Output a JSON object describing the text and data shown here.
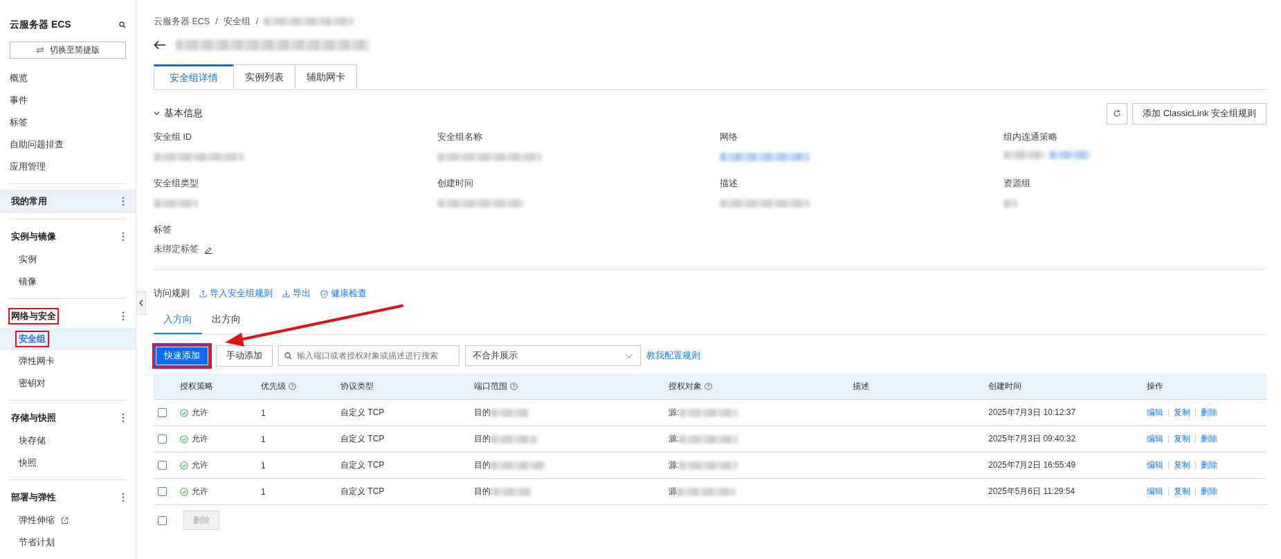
{
  "sidebar": {
    "title": "云服务器 ECS",
    "switch_button": "切换至简捷版",
    "links": [
      {
        "label": "概览",
        "selected": false
      },
      {
        "label": "事件",
        "selected": false
      },
      {
        "label": "标签",
        "selected": false
      },
      {
        "label": "自助问题排查",
        "selected": false
      },
      {
        "label": "应用管理",
        "selected": false
      }
    ],
    "groups": [
      {
        "title": "我的常用",
        "active": true,
        "annotated": false
      },
      {
        "title": "实例与镜像",
        "active": false,
        "annotated": false,
        "items": [
          {
            "label": "实例",
            "selected": false,
            "annotated": false,
            "external": false
          },
          {
            "label": "镜像",
            "selected": false,
            "annotated": false,
            "external": false
          }
        ]
      },
      {
        "title": "网络与安全",
        "active": false,
        "annotated": true,
        "items": [
          {
            "label": "安全组",
            "selected": true,
            "annotated": true,
            "external": false
          },
          {
            "label": "弹性网卡",
            "selected": false,
            "annotated": false,
            "external": false
          },
          {
            "label": "密钥对",
            "selected": false,
            "annotated": false,
            "external": false
          }
        ]
      },
      {
        "title": "存储与快照",
        "active": false,
        "annotated": false,
        "items": [
          {
            "label": "块存储",
            "selected": false,
            "annotated": false,
            "external": false
          },
          {
            "label": "快照",
            "selected": false,
            "annotated": false,
            "external": false
          }
        ]
      },
      {
        "title": "部署与弹性",
        "active": false,
        "annotated": false,
        "items": [
          {
            "label": "弹性伸缩",
            "selected": false,
            "annotated": false,
            "external": true
          },
          {
            "label": "节省计划",
            "selected": false,
            "annotated": false,
            "external": false
          }
        ]
      }
    ]
  },
  "breadcrumb": [
    {
      "kind": "link",
      "label": "云服务器 ECS"
    },
    {
      "kind": "separator",
      "label": "/"
    },
    {
      "kind": "link",
      "label": "安全组"
    },
    {
      "kind": "separator",
      "label": "/"
    },
    {
      "kind": "redacted"
    }
  ],
  "title_redacted": true,
  "tabs": [
    {
      "label": "安全组详情",
      "selected": true
    },
    {
      "label": "实例列表",
      "selected": false
    },
    {
      "label": "辅助网卡",
      "selected": false
    }
  ],
  "basic_info": {
    "title": "基本信息",
    "expanded": true,
    "action_button": "添加 ClassicLink 安全组规则",
    "fields": [
      {
        "label": "安全组 ID",
        "kind": "plain"
      },
      {
        "label": "安全组名称",
        "kind": "plain"
      },
      {
        "label": "网络",
        "kind": "link"
      },
      {
        "label": "组内连通策略",
        "kind": "mixed"
      },
      {
        "label": "安全组类型",
        "kind": "plain"
      },
      {
        "label": "创建时间",
        "kind": "plain"
      },
      {
        "label": "描述",
        "kind": "plain"
      },
      {
        "label": "资源组",
        "kind": "plain"
      }
    ],
    "tags": {
      "label": "标签",
      "value": "未绑定标签"
    }
  },
  "rules": {
    "title": "访问规则",
    "actions": [
      {
        "label": "导入安全组规则",
        "kind": "import"
      },
      {
        "label": "导出",
        "kind": "export"
      },
      {
        "label": "健康检查",
        "kind": "check"
      }
    ],
    "direction_tabs": [
      {
        "label": "入方向",
        "selected": true
      },
      {
        "label": "出方向",
        "selected": false
      }
    ],
    "buttons": [
      {
        "label": "快速添加",
        "primary": true,
        "annotated": true
      },
      {
        "label": "手动添加",
        "primary": false,
        "annotated": false
      }
    ],
    "search": {
      "placeholder": "输入端口或者授权对象或描述进行搜索"
    },
    "select": {
      "value": "不合并展示"
    },
    "help_link": "教我配置规则",
    "columns": [
      {
        "label": "授权策略",
        "help": false
      },
      {
        "label": "优先级",
        "help": true
      },
      {
        "label": "协议类型",
        "help": false
      },
      {
        "label": "端口范围",
        "help": true
      },
      {
        "label": "授权对象",
        "help": true
      },
      {
        "label": "描述",
        "help": false
      },
      {
        "label": "创建时间",
        "help": false
      },
      {
        "label": "操作",
        "help": false
      }
    ],
    "rows": [
      {
        "checked": false,
        "policy": "允许",
        "priority": "1",
        "protocol": "自定义 TCP",
        "port": "目的",
        "source": "源:",
        "created": "2025年7月3日 10:12:37",
        "actions": [
          "编辑",
          "复制",
          "删除"
        ]
      },
      {
        "checked": false,
        "policy": "允许",
        "priority": "1",
        "protocol": "自定义 TCP",
        "port": "目的",
        "source": "源:",
        "created": "2025年7月3日 09:40:32",
        "actions": [
          "编辑",
          "复制",
          "删除"
        ]
      },
      {
        "checked": false,
        "policy": "允许",
        "priority": "1",
        "protocol": "自定义 TCP",
        "port": "目的",
        "source": "源:",
        "created": "2025年7月2日 16:55:49",
        "actions": [
          "编辑",
          "复制",
          "删除"
        ]
      },
      {
        "checked": false,
        "policy": "允许",
        "priority": "1",
        "protocol": "自定义 TCP",
        "port": "目的:",
        "source": "源",
        "created": "2025年5月6日 11:29:54",
        "actions": [
          "编辑",
          "复制",
          "删除"
        ]
      }
    ],
    "footer": {
      "all_checked": false,
      "delete_button": "删除",
      "delete_disabled": true
    }
  },
  "annotation_arrow": true
}
